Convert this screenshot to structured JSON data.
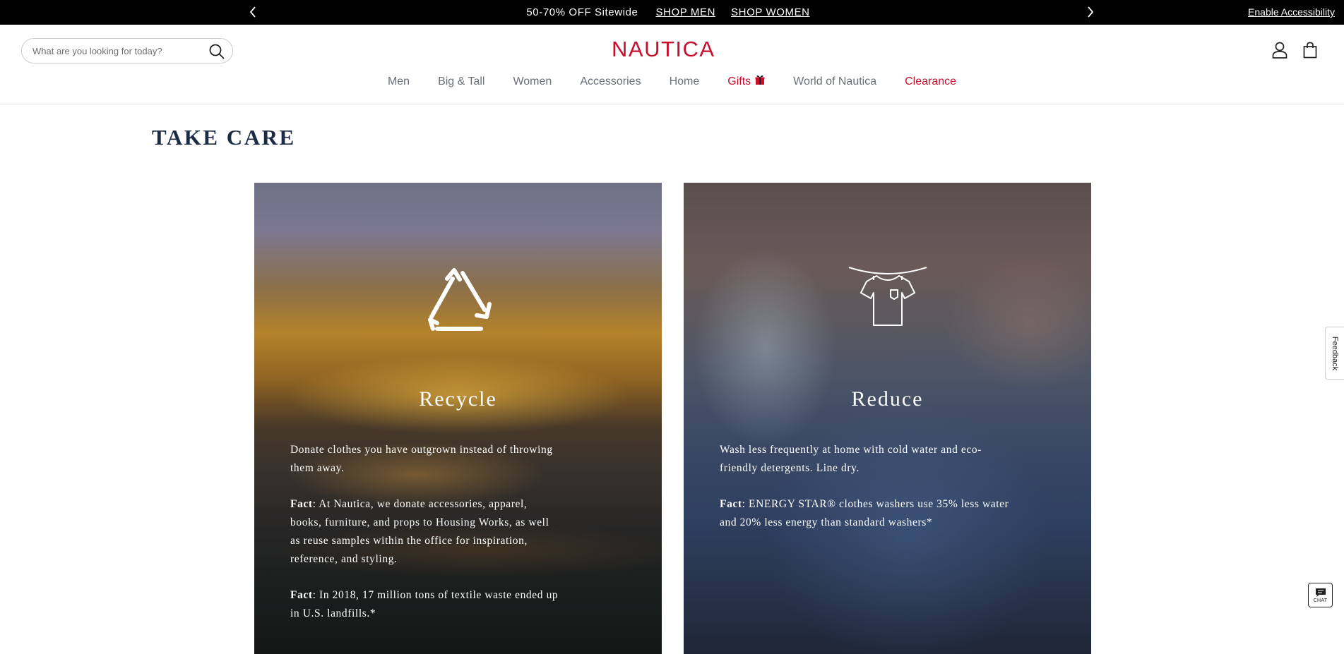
{
  "promo": {
    "offer": "50-70% OFF Sitewide",
    "links": [
      "SHOP MEN",
      "SHOP WOMEN"
    ],
    "accessibility": "Enable Accessibility"
  },
  "header": {
    "search_placeholder": "What are you looking for today?",
    "logo": "NAUTICA",
    "nav": [
      "Men",
      "Big & Tall",
      "Women",
      "Accessories",
      "Home",
      "Gifts",
      "World of Nautica",
      "Clearance"
    ]
  },
  "page": {
    "title": "TAKE CARE"
  },
  "panels": {
    "recycle": {
      "heading": "Recycle",
      "intro": "Donate clothes you have outgrown instead of throwing them away.",
      "fact1_label": "Fact",
      "fact1_text": ": At Nautica, we donate accessories, apparel, books, furniture, and props to Housing Works, as well as reuse samples within the office for inspiration, reference, and styling.",
      "fact2_label": "Fact",
      "fact2_text": ": In 2018, 17 million tons of textile waste ended up in U.S. landfills.*"
    },
    "reduce": {
      "heading": "Reduce",
      "intro": "Wash less frequently at home with cold water and eco-friendly detergents. Line dry.",
      "fact1_label": "Fact",
      "fact1_text": ": ENERGY STAR® clothes washers use 35% less water and 20% less energy than standard washers*"
    }
  },
  "widgets": {
    "feedback": "Feedback",
    "chat": "CHAT"
  },
  "colors": {
    "brand": "#c8102e",
    "title": "#1c2b45",
    "nav": "#6a6f78"
  }
}
